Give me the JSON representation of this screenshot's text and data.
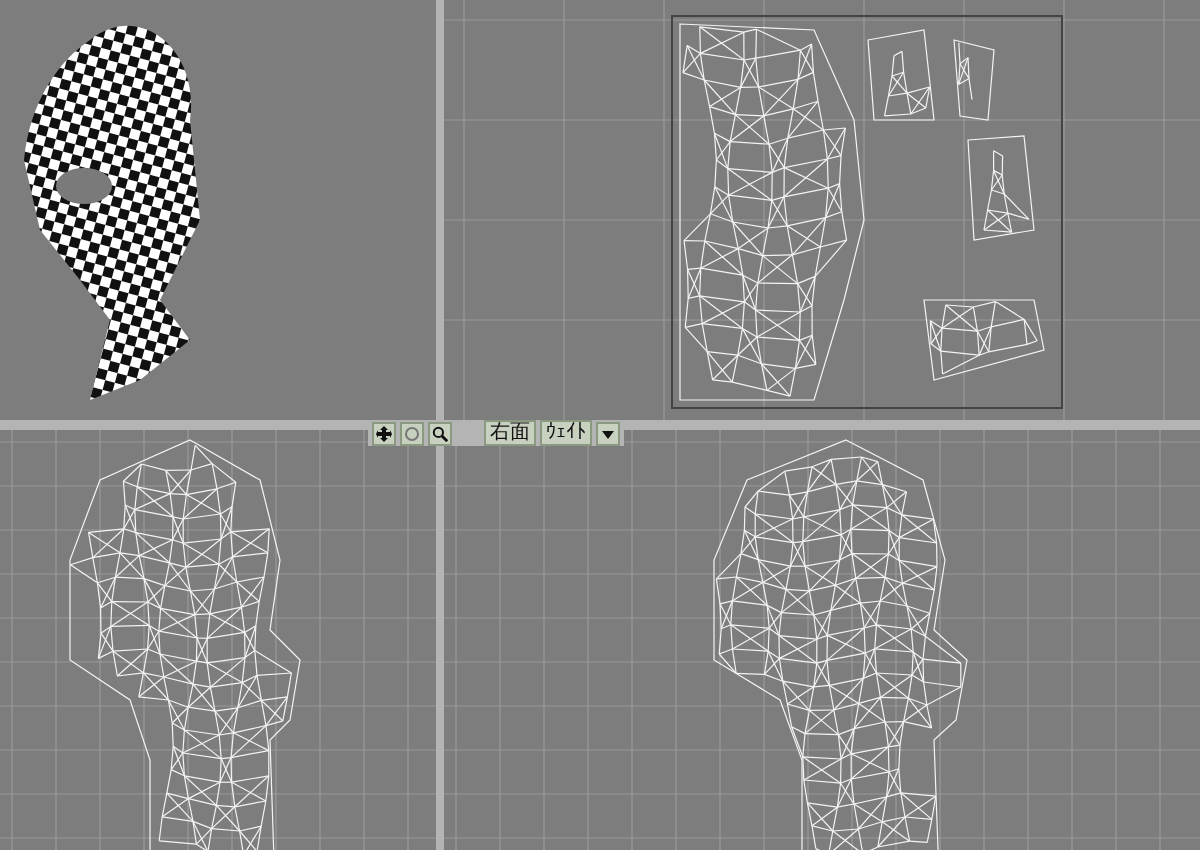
{
  "viewports": [
    {
      "kind": "checker"
    },
    {
      "kind": "uv"
    },
    {
      "kind": "front"
    },
    {
      "kind": "side"
    }
  ],
  "view_toolbar": {
    "view_label": "右面",
    "shading_label": "ｳｪｲﾄ"
  }
}
